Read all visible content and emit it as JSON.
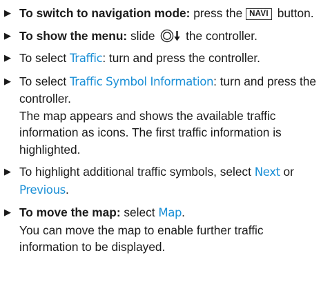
{
  "steps": [
    {
      "lead": "To switch to navigation mode:",
      "t1": " press the ",
      "key": "NAVI",
      "t2": " button."
    },
    {
      "lead": "To show the menu:",
      "t1": " slide ",
      "icon": "controller-slide-down-icon",
      "t2": " the controller."
    },
    {
      "t1": "To select ",
      "ui": "Traffic",
      "t2": ": turn and press the controller."
    },
    {
      "t1": "To select ",
      "ui": "Traffic Symbol Information",
      "t2": ": turn and press the controller.",
      "extra": "The map appears and shows the available traffic information as icons. The first traffic information is highlighted."
    },
    {
      "t1": "To highlight additional traffic symbols, select ",
      "ui1": "Next",
      "mid": " or ",
      "ui2": "Previous",
      "t2": "."
    },
    {
      "lead": "To move the map:",
      "t1": " select ",
      "ui": "Map",
      "t2": ".",
      "extra": "You can move the map to enable further traffic information to be displayed."
    }
  ],
  "colors": {
    "highlight": "#1a8fd6",
    "text": "#1a1a1a"
  }
}
